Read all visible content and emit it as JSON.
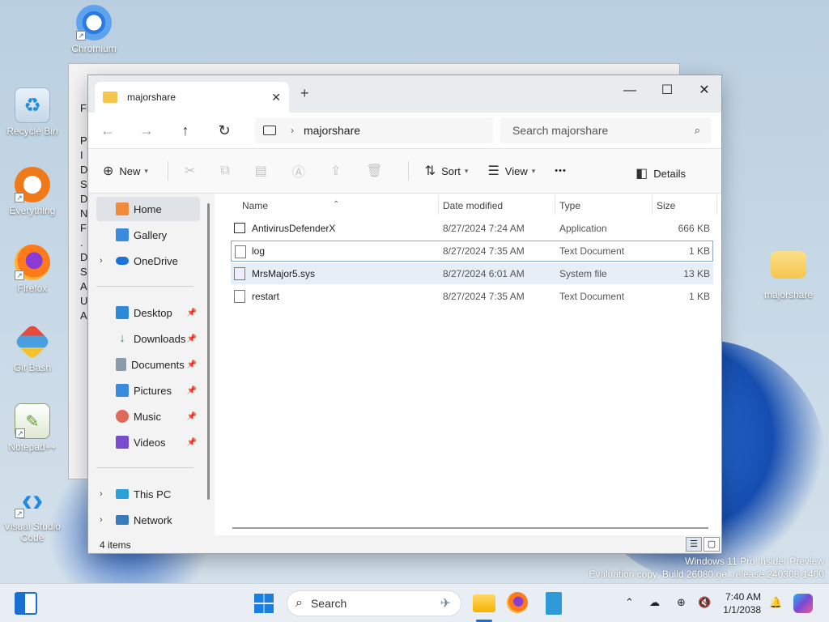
{
  "desktop": {
    "icons": [
      {
        "label": "Chromium"
      },
      {
        "label": "Recycle Bin"
      },
      {
        "label": "Everything"
      },
      {
        "label": "Firefox"
      },
      {
        "label": "Git Bash"
      },
      {
        "label": "Notepad++"
      },
      {
        "label": "Visual Studio Code"
      },
      {
        "label": "majorshare"
      }
    ]
  },
  "back_window": {
    "partial_letters": [
      "Fi",
      "P",
      "I",
      "D",
      "S",
      "D",
      "N",
      "F",
      ".",
      "D",
      "S",
      "A",
      "U",
      "A"
    ]
  },
  "explorer": {
    "tab_title": "majorshare",
    "tab_close": "✕",
    "new_tab": "+",
    "address": {
      "current": "majorshare"
    },
    "search": {
      "placeholder": "Search majorshare"
    },
    "toolbar": {
      "new_label": "New",
      "sort_label": "Sort",
      "view_label": "View",
      "more_label": "•••",
      "details_label": "Details"
    },
    "nav": {
      "home": "Home",
      "gallery": "Gallery",
      "onedrive": "OneDrive",
      "desktop": "Desktop",
      "downloads": "Downloads",
      "documents": "Documents",
      "pictures": "Pictures",
      "music": "Music",
      "videos": "Videos",
      "this_pc": "This PC",
      "network": "Network"
    },
    "columns": {
      "name": "Name",
      "date": "Date modified",
      "type": "Type",
      "size": "Size"
    },
    "files": [
      {
        "name": "AntivirusDefenderX",
        "date": "8/27/2024 7:24 AM",
        "type": "Application",
        "size": "666 KB"
      },
      {
        "name": "log",
        "date": "8/27/2024 7:35 AM",
        "type": "Text Document",
        "size": "1 KB"
      },
      {
        "name": "MrsMajor5.sys",
        "date": "8/27/2024 6:01 AM",
        "type": "System file",
        "size": "13 KB"
      },
      {
        "name": "restart",
        "date": "8/27/2024 7:35 AM",
        "type": "Text Document",
        "size": "1 KB"
      }
    ],
    "status": {
      "count": "4 items"
    }
  },
  "watermark": {
    "line1": "Windows 11 Pro Insider Preview",
    "line2": "Evaluation copy. Build 26080.ge_release.240308-1400"
  },
  "taskbar": {
    "search_label": "Search",
    "time": "7:40 AM",
    "date": "1/1/2038"
  },
  "colors": {
    "accent": "#0067c0",
    "folder": "#f4c64e",
    "selection": "#e6eef8"
  }
}
